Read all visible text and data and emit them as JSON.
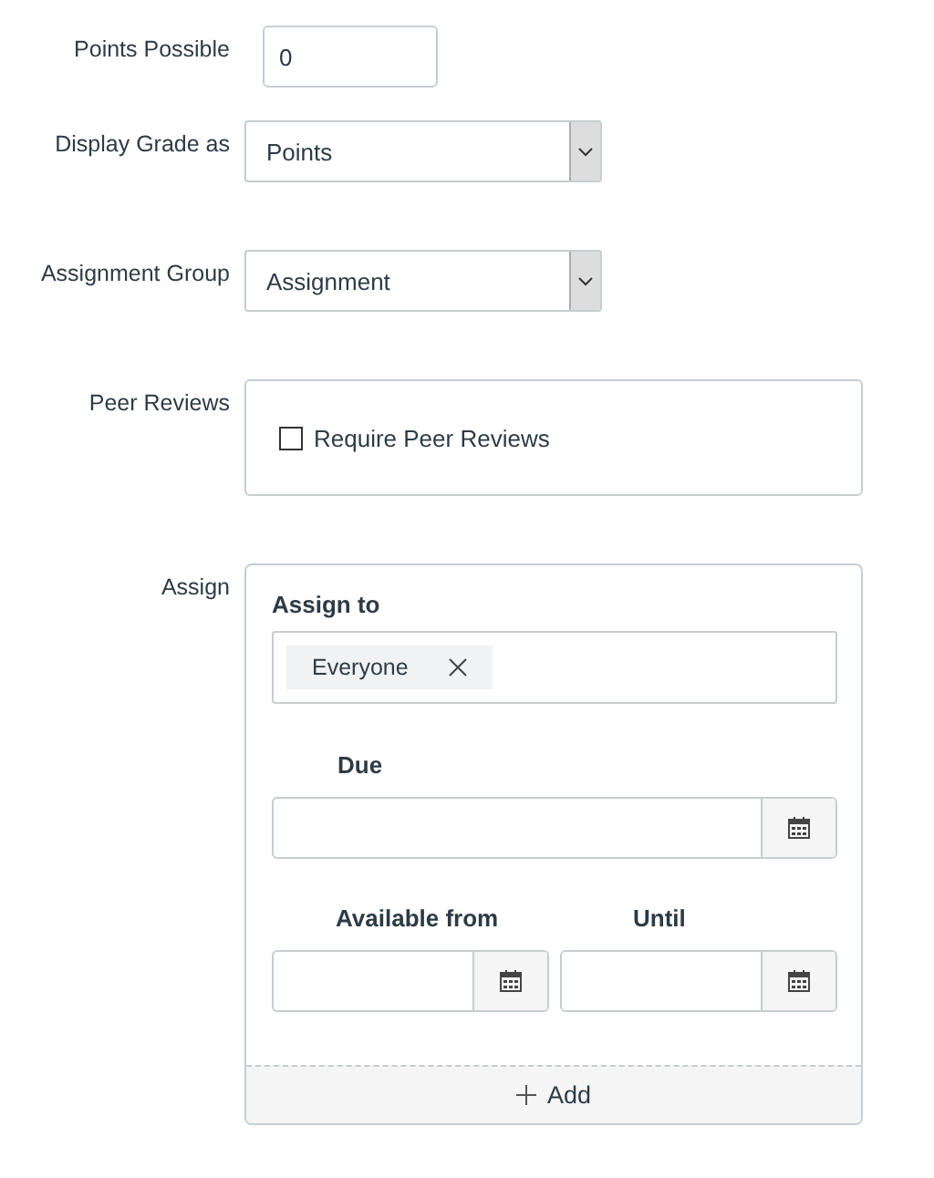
{
  "fields": [
    {
      "label": "Points Possible",
      "kind": "text",
      "value": "0"
    },
    {
      "label": "Display Grade as",
      "kind": "select",
      "value": "Points"
    },
    {
      "label": "Assignment Group",
      "kind": "select",
      "value": "Assignment"
    },
    {
      "label": "Peer Reviews",
      "kind": "checkbox",
      "option": "Require Peer Reviews",
      "checked": false
    }
  ],
  "assign": {
    "label": "Assign",
    "heading": "Assign to",
    "assignees": [
      "Everyone"
    ],
    "due": {
      "label": "Due"
    },
    "available_from": {
      "label": "Available from"
    },
    "until": {
      "label": "Until"
    },
    "add_button": "Add"
  }
}
